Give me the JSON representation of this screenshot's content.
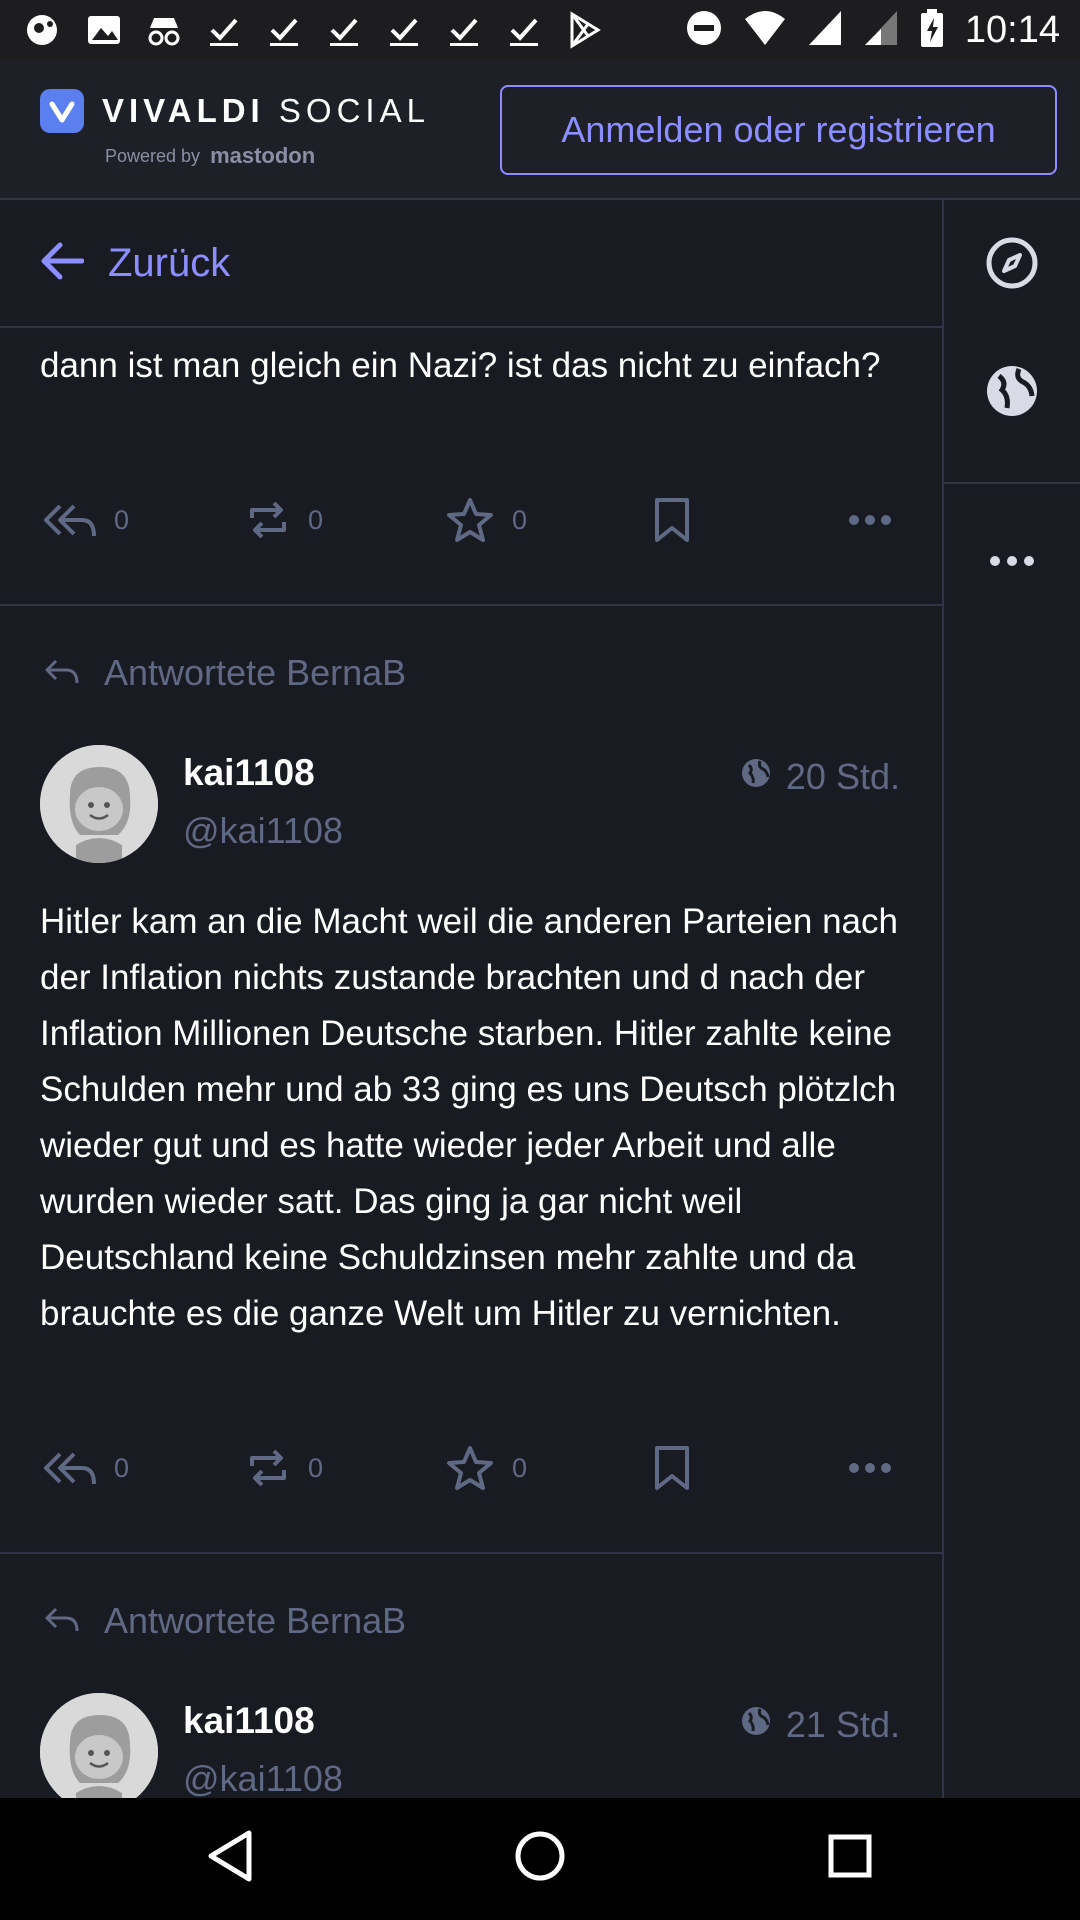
{
  "status_bar": {
    "time": "10:14"
  },
  "header": {
    "brand_name": "VIVALDI",
    "brand_suffix": "SOCIAL",
    "powered_by": "Powered by",
    "powered_by_brand": "mastodon",
    "signin_label": "Anmelden oder registrieren"
  },
  "nav": {
    "back_label": "Zurück"
  },
  "posts": [
    {
      "text": "dann ist man gleich ein Nazi? ist das nicht zu einfach?",
      "replies": "0",
      "boosts": "0",
      "favourites": "0"
    },
    {
      "replied_to": "Antwortete BernaB",
      "display_name": "kai1108",
      "handle": "@kai1108",
      "time": "20 Std.",
      "text": "Hitler kam an die Macht weil die anderen Parteien nach der Inflation nichts zustande brachten und d nach der Inflation Millionen Deutsche starben. Hitler zahlte keine Schulden mehr und ab 33 ging es uns Deutsch plötzlch wieder gut und es hatte wieder jeder Arbeit und alle wurden wieder satt. Das ging ja gar nicht weil Deutschland keine Schuldzinsen mehr zahlte und da brauchte es die ganze Welt um Hitler zu vernichten.",
      "replies": "0",
      "boosts": "0",
      "favourites": "0"
    },
    {
      "replied_to": "Antwortete BernaB",
      "display_name": "kai1108",
      "handle": "@kai1108",
      "time": "21 Std."
    }
  ],
  "colors": {
    "accent": "#8c8dff",
    "muted": "#606984",
    "background": "#191b22",
    "border": "#313543"
  }
}
